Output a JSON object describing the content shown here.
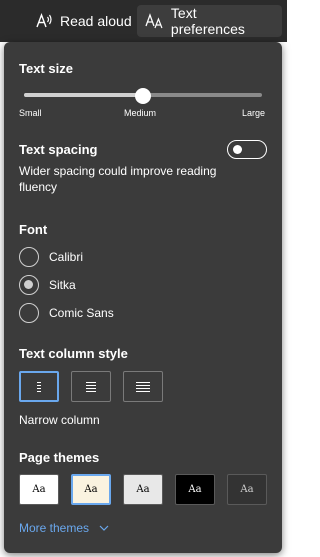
{
  "toolbar": {
    "read_aloud_label": "Read aloud",
    "text_preferences_label": "Text preferences"
  },
  "text_size": {
    "heading": "Text size",
    "labels": {
      "small": "Small",
      "medium": "Medium",
      "large": "Large"
    },
    "value_fraction": 0.5
  },
  "text_spacing": {
    "heading": "Text spacing",
    "description": "Wider spacing could improve reading fluency",
    "enabled": false
  },
  "font": {
    "heading": "Font",
    "options": [
      {
        "label": "Calibri",
        "selected": false
      },
      {
        "label": "Sitka",
        "selected": true
      },
      {
        "label": "Comic Sans",
        "selected": false
      }
    ]
  },
  "column_style": {
    "heading": "Text column style",
    "selected_label": "Narrow column",
    "options": [
      "narrow",
      "medium",
      "wide"
    ],
    "selected_index": 0
  },
  "page_themes": {
    "heading": "Page themes",
    "sample_text": "Aa",
    "themes": [
      {
        "bg": "#ffffff",
        "fg": "#000000",
        "selected": false
      },
      {
        "bg": "#faf3e0",
        "fg": "#000000",
        "selected": true
      },
      {
        "bg": "#e8e8e8",
        "fg": "#000000",
        "selected": false
      },
      {
        "bg": "#000000",
        "fg": "#ffffff",
        "selected": false
      },
      {
        "bg": "#333333",
        "fg": "#d0d0d0",
        "selected": false
      }
    ],
    "more_label": "More themes"
  },
  "colors": {
    "accent": "#6aa8ee",
    "panel_bg": "#3b3b3b",
    "toolbar_bg": "#2b2b2b"
  }
}
